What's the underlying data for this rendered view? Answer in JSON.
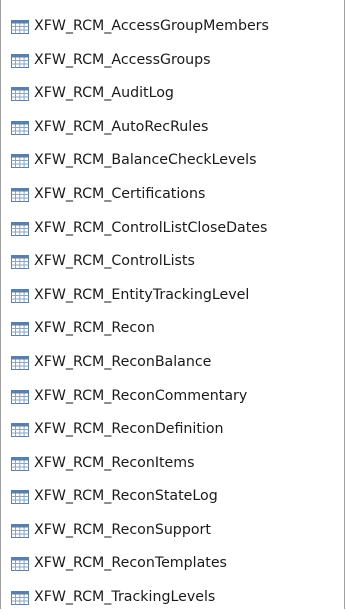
{
  "tables": [
    {
      "name": "XFW_RCM_AccessGroupMembers",
      "icon": "table-icon"
    },
    {
      "name": "XFW_RCM_AccessGroups",
      "icon": "table-icon"
    },
    {
      "name": "XFW_RCM_AuditLog",
      "icon": "table-icon"
    },
    {
      "name": "XFW_RCM_AutoRecRules",
      "icon": "table-icon"
    },
    {
      "name": "XFW_RCM_BalanceCheckLevels",
      "icon": "table-icon"
    },
    {
      "name": "XFW_RCM_Certifications",
      "icon": "table-icon"
    },
    {
      "name": "XFW_RCM_ControlListCloseDates",
      "icon": "table-icon"
    },
    {
      "name": "XFW_RCM_ControlLists",
      "icon": "table-icon"
    },
    {
      "name": "XFW_RCM_EntityTrackingLevel",
      "icon": "table-icon"
    },
    {
      "name": "XFW_RCM_Recon",
      "icon": "table-icon"
    },
    {
      "name": "XFW_RCM_ReconBalance",
      "icon": "table-icon"
    },
    {
      "name": "XFW_RCM_ReconCommentary",
      "icon": "table-icon"
    },
    {
      "name": "XFW_RCM_ReconDefinition",
      "icon": "table-icon"
    },
    {
      "name": "XFW_RCM_ReconItems",
      "icon": "table-icon"
    },
    {
      "name": "XFW_RCM_ReconStateLog",
      "icon": "table-icon"
    },
    {
      "name": "XFW_RCM_ReconSupport",
      "icon": "table-icon"
    },
    {
      "name": "XFW_RCM_ReconTemplates",
      "icon": "table-icon"
    },
    {
      "name": "XFW_RCM_TrackingLevels",
      "icon": "table-icon"
    }
  ],
  "colors": {
    "icon_header": "#5a7fa8",
    "icon_grid": "#8aa6c4",
    "icon_cell": "#ffffff",
    "text": "#1a1a1a"
  }
}
